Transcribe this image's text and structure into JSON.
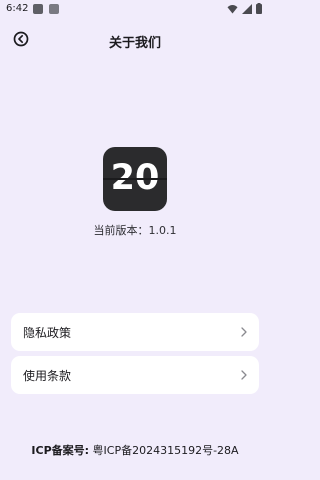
{
  "status_bar": {
    "time": "6:42",
    "icons": [
      "app-notification-icon",
      "app-notification-icon",
      "wifi-icon",
      "signal-icon",
      "battery-icon"
    ]
  },
  "header": {
    "title": "关于我们",
    "back_icon": "back-arrow-icon"
  },
  "app_logo": {
    "text": "20",
    "background_color": "#2b2b2d"
  },
  "version": {
    "label": "当前版本：",
    "value": "1.0.1"
  },
  "menu": {
    "items": [
      {
        "label": "隐私政策",
        "icon": "chevron-right-icon"
      },
      {
        "label": "使用条款",
        "icon": "chevron-right-icon"
      }
    ]
  },
  "footer": {
    "icp_label": "ICP备案号:",
    "icp_value": "粤ICP备2024315192号-28A"
  },
  "colors": {
    "background": "#f1ecfb",
    "card": "#ffffff",
    "text": "#1c1b1f"
  }
}
